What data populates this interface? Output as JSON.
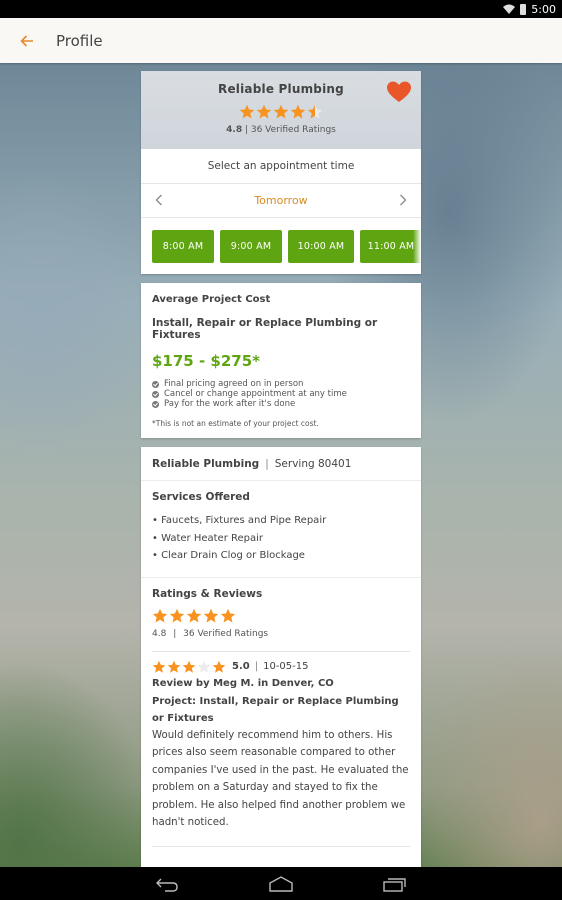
{
  "status_bar": {
    "time": "5:00"
  },
  "app_bar": {
    "title": "Profile",
    "back_icon": "arrow-left-icon"
  },
  "provider_card": {
    "name": "Reliable Plumbing",
    "favorite_icon": "heart-icon",
    "rating": 4.8,
    "rating_stars_fraction": 0.9,
    "rating_value": "4.8",
    "rating_count": "36 Verified Ratings",
    "rating_separator": " | ",
    "appointment_label": "Select an appointment time",
    "day_label": "Tomorrow",
    "prev_icon": "chevron-left-icon",
    "next_icon": "chevron-right-icon",
    "time_slots": [
      "8:00 AM",
      "9:00 AM",
      "10:00 AM",
      "11:00 AM"
    ]
  },
  "cost_card": {
    "heading": "Average Project Cost",
    "project": "Install, Repair or Replace Plumbing or Fixtures",
    "price_range": "$175 - $275*",
    "benefits": [
      "Final pricing agreed on in person",
      "Cancel or change appointment at any time",
      "Pay for the work after it's done"
    ],
    "note": "*This is not an estimate of your project cost."
  },
  "info_card": {
    "business_name": "Reliable Plumbing",
    "separator": "|",
    "serving": "Serving 80401",
    "services_heading": "Services Offered",
    "services": [
      "• Faucets, Fixtures and Pipe Repair",
      "• Water Heater Repair",
      "• Clear Drain Clog or Blockage"
    ],
    "reviews_heading": "Ratings & Reviews",
    "summary_stars": 5,
    "summary_rating": "4.8",
    "summary_separator": "|",
    "summary_count": "36 Verified Ratings",
    "review": {
      "stars": [
        true,
        true,
        true,
        false,
        true
      ],
      "score": "5.0",
      "separator": "|",
      "date": "10-05-15",
      "author": "Review by Meg M. in Denver, CO",
      "project": "Project: Install, Repair or Replace Plumbing or Fixtures",
      "body": "Would definitely recommend him to others. His prices also seem reasonable compared to other companies I've used in the past. He evaluated the problem on a Saturday and stayed to fix the problem. He also helped find another problem we hadn't noticed."
    }
  },
  "nav_bar": {
    "back_icon": "nav-back-icon",
    "home_icon": "nav-home-icon",
    "recents_icon": "nav-recents-icon"
  },
  "colors": {
    "accent_orange": "#e8892c",
    "star_orange": "#f7931e",
    "heart_red": "#e8562a",
    "slot_green": "#5fa511",
    "price_green": "#5fa511",
    "day_orange": "#d98b22",
    "app_bar_bg": "#faf8f4"
  }
}
